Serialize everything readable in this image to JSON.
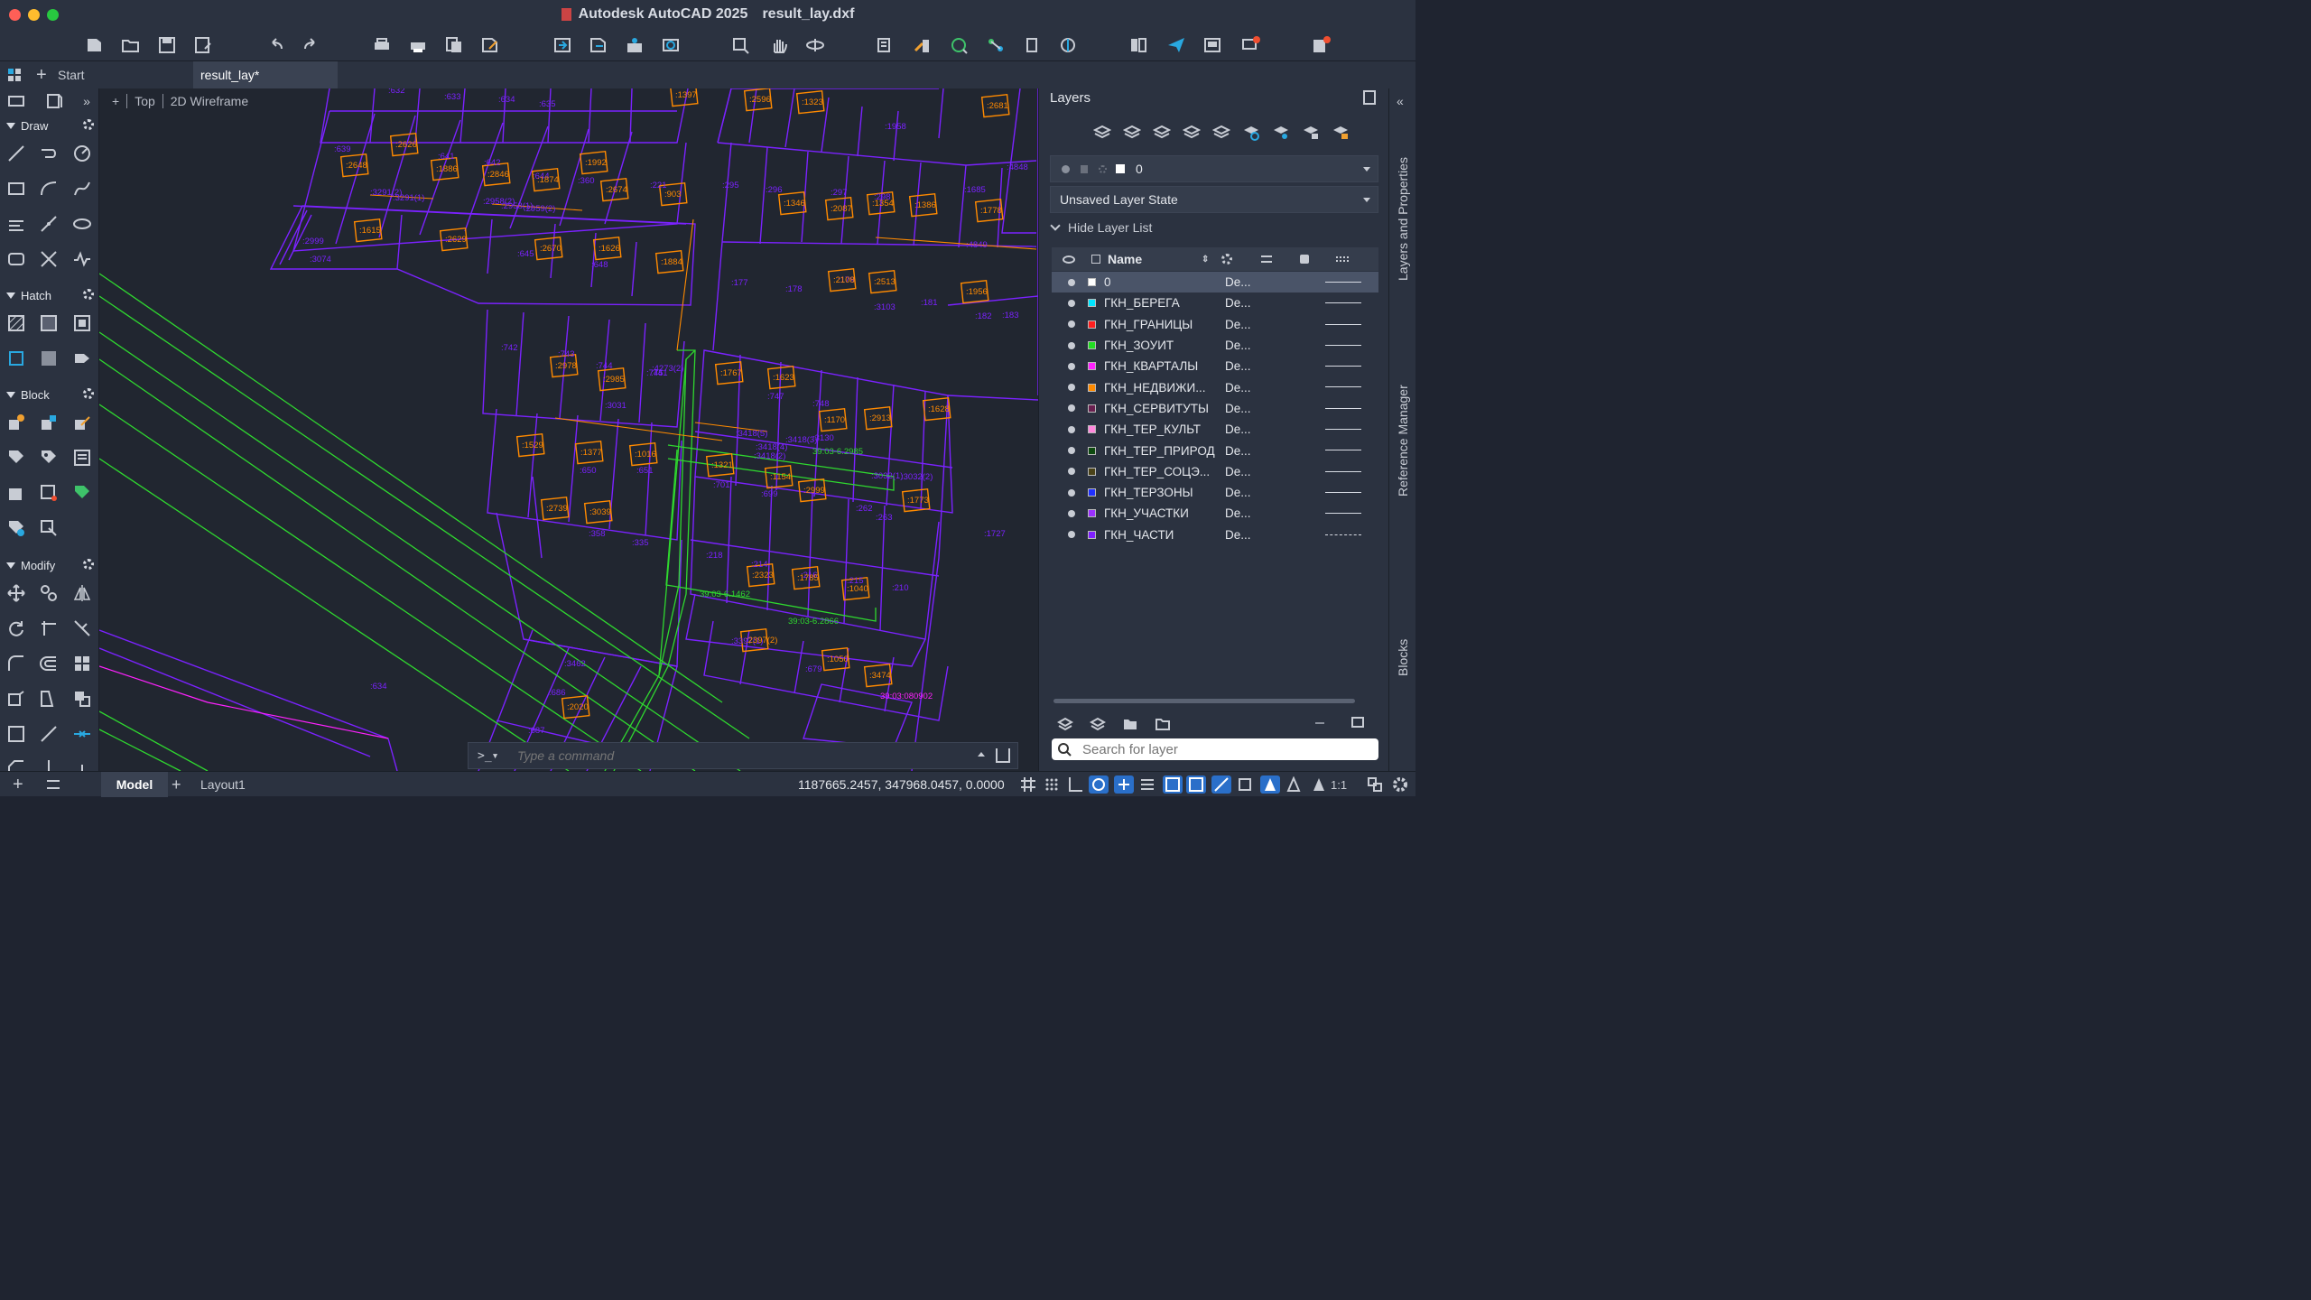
{
  "app": {
    "name": "Autodesk AutoCAD 2025",
    "file": "result_lay.dxf"
  },
  "tabs": [
    {
      "label": "Start"
    },
    {
      "label": "result_lay*"
    }
  ],
  "viewport": {
    "plus": "+",
    "view": "Top",
    "style": "2D Wireframe"
  },
  "left_panel": {
    "sections": [
      {
        "label": "Draw"
      },
      {
        "label": "Hatch"
      },
      {
        "label": "Block"
      },
      {
        "label": "Modify"
      }
    ]
  },
  "command": {
    "prompt": ">_▾",
    "placeholder": "Type a command"
  },
  "layers_panel": {
    "title": "Layers",
    "current_layer": "0",
    "layer_state": "Unsaved Layer State",
    "hide_list_label": "Hide Layer List",
    "column_name": "Name",
    "layers": [
      {
        "name": "0",
        "color": "#ffffff",
        "material": "De...",
        "linetype": "solid",
        "selected": true
      },
      {
        "name": "ГКН_БЕРЕГА",
        "color": "#00e5ff",
        "material": "De...",
        "linetype": "solid"
      },
      {
        "name": "ГКН_ГРАНИЦЫ",
        "color": "#ff2020",
        "material": "De...",
        "linetype": "solid"
      },
      {
        "name": "ГКН_ЗОУИТ",
        "color": "#22dd22",
        "material": "De...",
        "linetype": "solid"
      },
      {
        "name": "ГКН_КВАРТАЛЫ",
        "color": "#ff22ff",
        "material": "De...",
        "linetype": "solid"
      },
      {
        "name": "ГКН_НЕДВИЖИ...",
        "color": "#ff8a00",
        "material": "De...",
        "linetype": "solid"
      },
      {
        "name": "ГКН_СЕРВИТУТЫ",
        "color": "#6a2050",
        "material": "De...",
        "linetype": "solid"
      },
      {
        "name": "ГКН_ТЕР_КУЛЬТ",
        "color": "#ff88dd",
        "material": "De...",
        "linetype": "solid"
      },
      {
        "name": "ГКН_ТЕР_ПРИРОД",
        "color": "#0e4a10",
        "material": "De...",
        "linetype": "solid"
      },
      {
        "name": "ГКН_ТЕР_СОЦЭ...",
        "color": "#4a4218",
        "material": "De...",
        "linetype": "solid"
      },
      {
        "name": "ГКН_ТЕРЗОНЫ",
        "color": "#2030ff",
        "material": "De...",
        "linetype": "solid"
      },
      {
        "name": "ГКН_УЧАСТКИ",
        "color": "#9a30ff",
        "material": "De...",
        "linetype": "solid"
      },
      {
        "name": "ГКН_ЧАСТИ",
        "color": "#8020ff",
        "material": "De...",
        "linetype": "dashed"
      }
    ],
    "search_placeholder": "Search for layer"
  },
  "side_tabs": [
    {
      "label": "Layers and Properties"
    },
    {
      "label": "Reference Manager"
    },
    {
      "label": "Blocks"
    }
  ],
  "status": {
    "model_tab": "Model",
    "layout_tab": "Layout1",
    "coordinates": "1187665.2457, 347968.0457, 0.0000",
    "scale": "1:1"
  },
  "drawing_labels": {
    "parcels_purple": [
      ":632",
      ":633",
      ":634",
      ":635",
      ":639",
      ":641",
      ":642",
      ":644",
      ":360",
      ":221",
      ":295",
      ":296",
      ":297",
      ":298",
      ":1958",
      ":1685",
      ":4848",
      ":4849",
      ":3291(2)",
      ":3291(1)",
      ":2958(2)",
      ":2958(1)",
      ":2959(2)",
      ":2999",
      ":3074",
      ":645",
      ":648",
      ":177",
      ":178",
      ":179",
      ":3103",
      ":181",
      ":182",
      ":183",
      ":742",
      ":743",
      ":744",
      ":745",
      ":747",
      ":748",
      ":741",
      ":3031",
      ":4273(2)",
      ":3418(5)",
      ":3418(4)",
      ":3418(2)",
      ":3418(3)",
      ":3130",
      ":3032(1)",
      ":3032(2)",
      ":650",
      ":651",
      ":701",
      ":699",
      ":262",
      ":263",
      ":358",
      ":335",
      ":218",
      ":214",
      ":216",
      ":215",
      ":210",
      ":1727",
      ":3462",
      ":686",
      ":687",
      ":679",
      ":3397(1)",
      ":634"
    ],
    "buildings_orange": [
      ":2626",
      ":2648",
      ":1886",
      ":2846",
      ":1874",
      ":1992",
      ":2674",
      ":903",
      ":1397",
      ":2596",
      ":1323",
      ":2681",
      ":1346",
      ":2087",
      ":1354",
      ":1386",
      ":1778",
      ":1615",
      ":2629",
      ":2670",
      ":1626",
      ":1884",
      ":2108",
      ":2513",
      ":1956",
      ":2978",
      ":2985",
      ":1767",
      ":1623",
      ":1170",
      ":2913",
      ":1628",
      ":1529",
      ":1377",
      ":1016",
      ":1321",
      ":1154",
      ":2999",
      ":1773",
      ":2739",
      ":3039",
      ":2323",
      ":1785",
      ":1040",
      ":2397(2)",
      ":1050",
      ":3474",
      ":2020"
    ],
    "zones_green": [
      "39:03-6.2985",
      "39:03-6.1462",
      "39:03-6.2866"
    ],
    "other_magenta": [
      "39:03:080902"
    ]
  }
}
